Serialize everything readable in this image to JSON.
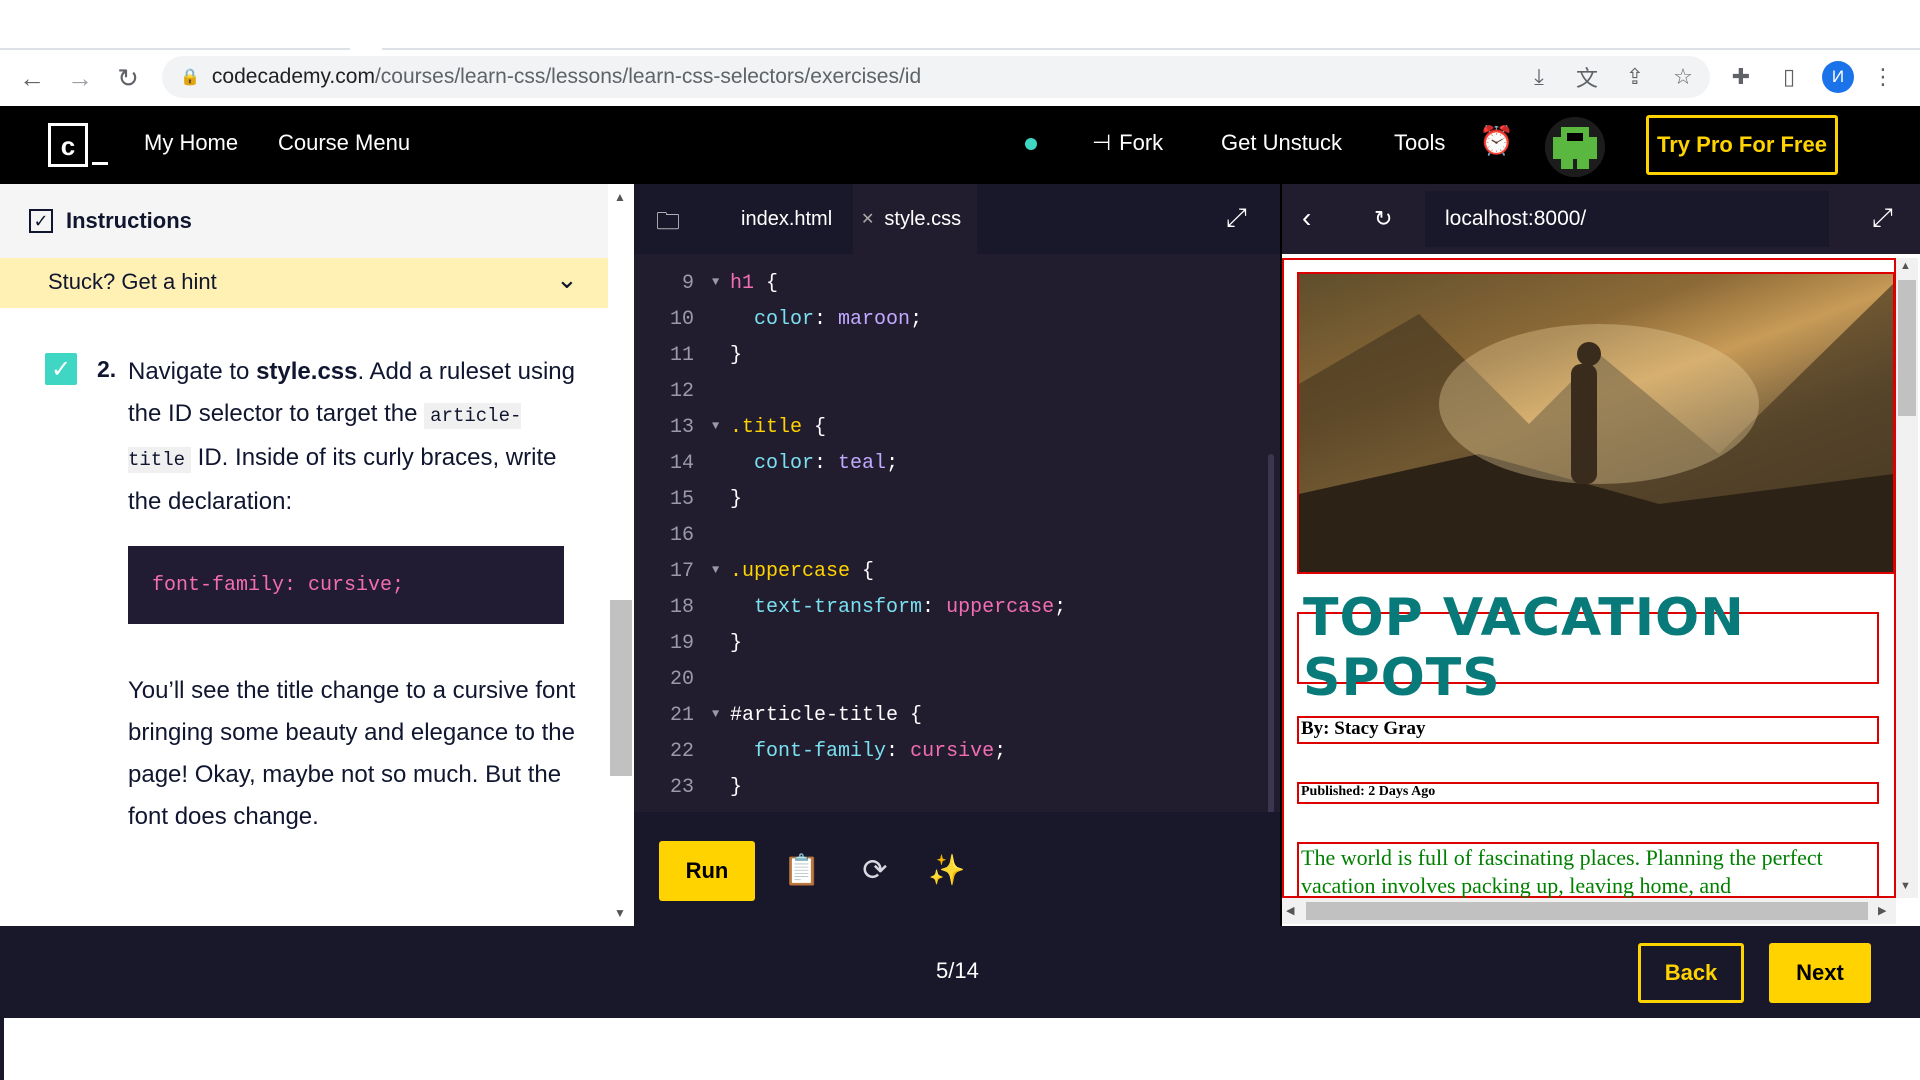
{
  "browser": {
    "url_host": "codecademy.com",
    "url_path": "/courses/learn-css/lessons/learn-css-selectors/exercises/id",
    "profile_initial": "И"
  },
  "header": {
    "nav": [
      "My Home",
      "Course Menu"
    ],
    "fork": "Fork",
    "get_unstuck": "Get Unstuck",
    "tools": "Tools",
    "try_pro": "Try Pro For Free",
    "logo_letter": "c"
  },
  "instructions": {
    "title": "Instructions",
    "hint": "Stuck? Get a hint",
    "step_number": "2.",
    "p1_before": "Navigate to ",
    "p1_file": "style.css",
    "p1_after": ". Add a ruleset using the ID selector to target the",
    "p1_code": "article-title",
    "p1_end": " ID. Inside of its curly braces, write the declaration:",
    "code_block": "font-family: cursive;",
    "p2": "You’ll see the title change to a cursive font bringing some beauty and elegance to the page! Okay, maybe not so much. But the font does change."
  },
  "editor": {
    "tabs": [
      "index.html",
      "style.css"
    ],
    "lines": [
      {
        "n": "9",
        "fold": true,
        "parts": [
          [
            "sel-h1",
            "h1"
          ],
          [
            "",
            " {"
          ]
        ]
      },
      {
        "n": "10",
        "fold": false,
        "parts": [
          [
            "",
            "  "
          ],
          [
            "prop",
            "color"
          ],
          [
            "",
            ": "
          ],
          [
            "val-b",
            "maroon"
          ],
          [
            "",
            ";"
          ]
        ]
      },
      {
        "n": "11",
        "fold": false,
        "parts": [
          [
            "",
            "}"
          ]
        ]
      },
      {
        "n": "12",
        "fold": false,
        "parts": []
      },
      {
        "n": "13",
        "fold": true,
        "parts": [
          [
            "sel-cls",
            ".title"
          ],
          [
            "",
            " {"
          ]
        ]
      },
      {
        "n": "14",
        "fold": false,
        "parts": [
          [
            "",
            "  "
          ],
          [
            "prop",
            "color"
          ],
          [
            "",
            ": "
          ],
          [
            "val-b",
            "teal"
          ],
          [
            "",
            ";"
          ]
        ]
      },
      {
        "n": "15",
        "fold": false,
        "parts": [
          [
            "",
            "}"
          ]
        ]
      },
      {
        "n": "16",
        "fold": false,
        "parts": []
      },
      {
        "n": "17",
        "fold": true,
        "parts": [
          [
            "sel-cls",
            ".uppercase"
          ],
          [
            "",
            " {"
          ]
        ]
      },
      {
        "n": "18",
        "fold": false,
        "parts": [
          [
            "",
            "  "
          ],
          [
            "prop",
            "text-transform"
          ],
          [
            "",
            ": "
          ],
          [
            "val",
            "uppercase"
          ],
          [
            "",
            ";"
          ]
        ]
      },
      {
        "n": "19",
        "fold": false,
        "parts": [
          [
            "",
            "}"
          ]
        ]
      },
      {
        "n": "20",
        "fold": false,
        "parts": []
      },
      {
        "n": "21",
        "fold": true,
        "parts": [
          [
            "sel-id",
            "#article-title"
          ],
          [
            "",
            " {"
          ]
        ]
      },
      {
        "n": "22",
        "fold": false,
        "parts": [
          [
            "",
            "  "
          ],
          [
            "prop",
            "font-family"
          ],
          [
            "",
            ": "
          ],
          [
            "val",
            "cursive"
          ],
          [
            "",
            ";"
          ]
        ]
      },
      {
        "n": "23",
        "fold": false,
        "parts": [
          [
            "",
            "}"
          ]
        ]
      }
    ],
    "run": "Run"
  },
  "preview": {
    "url": "localhost:8000/",
    "title": "TOP VACATION SPOTS",
    "byline": "By: Stacy Gray",
    "published": "Published: 2 Days Ago",
    "body": "The world is full of fascinating places. Planning the perfect vacation involves packing up, leaving home, and"
  },
  "footer": {
    "progress": "5/14",
    "back": "Back",
    "next": "Next"
  }
}
